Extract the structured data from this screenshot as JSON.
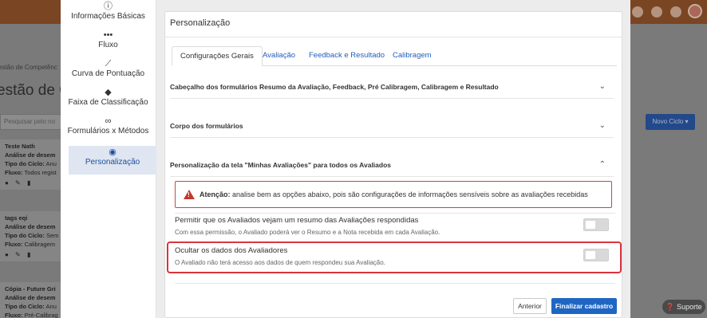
{
  "background": {
    "breadcrumb": "estão de Competênc",
    "title": "estão de C",
    "search_placeholder": "Pesquisar pelo no",
    "new_cycle_button": "Novo Ciclo",
    "cards": [
      {
        "name": "Teste Nath",
        "l1": "Análise de desem",
        "l2k": "Tipo do Ciclo:",
        "l2v": "Anu",
        "l3k": "Fluxo:",
        "l3v": "Todos regist"
      },
      {
        "name": "tags eqi",
        "l1": "Análise de desem",
        "l2k": "Tipo do Ciclo:",
        "l2v": "Sem",
        "l3k": "Fluxo:",
        "l3v": "Calibragem"
      },
      {
        "name": "Cópia - Future Gri",
        "l1": "Análise de desem",
        "l2k": "Tipo do Ciclo:",
        "l2v": "Anu",
        "l3k": "Fluxo:",
        "l3v": "Pré-Calibrag"
      }
    ]
  },
  "sidebar": {
    "items": [
      {
        "label": "Informações Básicas",
        "icon": "info-icon"
      },
      {
        "label": "Fluxo",
        "icon": "flow-icon"
      },
      {
        "label": "Curva de Pontuação",
        "icon": "chart-line-icon"
      },
      {
        "label": "Faixa de Classificação",
        "icon": "tag-icon"
      },
      {
        "label": "Formulários x Métodos",
        "icon": "link-icon"
      },
      {
        "label": "Personalização",
        "icon": "eye-icon"
      }
    ]
  },
  "panel": {
    "title": "Personalização",
    "tabs": [
      "Configurações Gerais",
      "Avaliação",
      "Feedback e Resultado",
      "Calibragem"
    ],
    "accordions": [
      "Cabeçalho dos formulários Resumo da Avaliação, Feedback, Pré Calibragem, Calibragem e Resultado",
      "Corpo dos formulários",
      "Personalização da tela \"Minhas Avaliações\" para todos os Avaliados"
    ],
    "warning_strong": "Atenção:",
    "warning_text": " analise bem as opções abaixo, pois são configurações de informações sensíveis sobre as avaliações recebidas",
    "options": [
      {
        "title": "Permitir que os Avaliados vejam um resumo das Avaliações respondidas",
        "desc": "Com essa permissão, o Avaliado poderá ver o Resumo e a Nota recebida em cada Avaliação.",
        "enabled": false
      },
      {
        "title": "Ocultar os dados dos Avaliadores",
        "desc": "O Avaliado não terá acesso aos dados de quem respondeu sua Avaliação.",
        "enabled": false
      }
    ],
    "btn_prev": "Anterior",
    "btn_finish": "Finalizar cadastro"
  },
  "support_label": "Suporte",
  "colors": {
    "accent": "#1f66c4",
    "highlight": "#d9343f",
    "active_bg": "#dfe6f1"
  }
}
